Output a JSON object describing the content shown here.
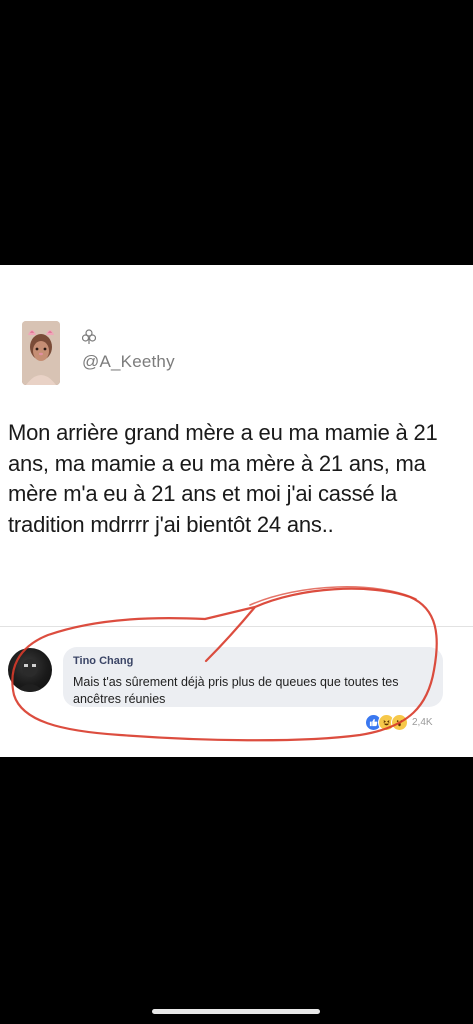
{
  "tweet": {
    "handle": "@A_Keethy",
    "text": "Mon arrière grand mère a eu ma mamie à 21 ans, ma mamie a eu ma mère à 21 ans, ma mère m'a eu à 21 ans et moi j'ai cassé la tradition mdrrrr j'ai bientôt 24 ans..",
    "icons": [
      "avatar",
      "club-icon"
    ]
  },
  "comment": {
    "author": "Tino Chang",
    "text": "Mais t'as sûrement déjà pris plus de queues que toutes tes ancêtres réunies",
    "reaction_count": "2,4K",
    "reactions": [
      "like",
      "haha",
      "wow"
    ]
  },
  "colors": {
    "background": "#000000",
    "card": "#ffffff",
    "handle": "#7c7c7c",
    "comment_bubble": "#eceef2",
    "comment_author": "#3b4566",
    "annotation_circle": "#d83a2a",
    "like_blue": "#3a78f0",
    "emoji_yellow": "#f6c84a"
  }
}
